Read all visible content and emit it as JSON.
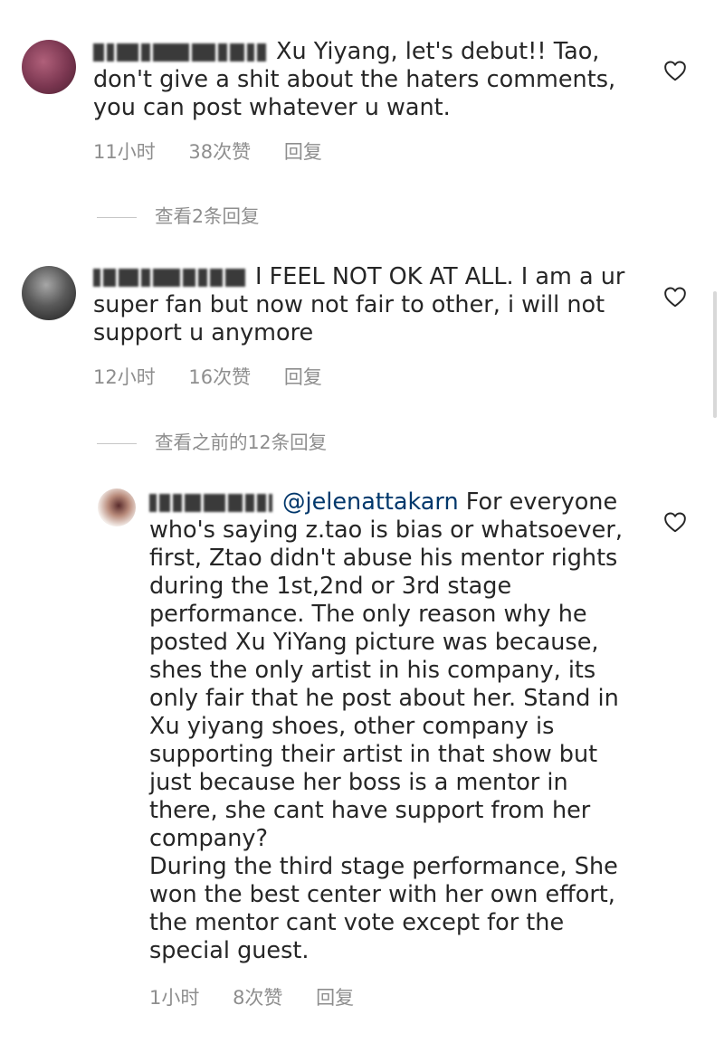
{
  "comments": [
    {
      "text": "Xu Yiyang, let's debut!! Tao, don't give a shit about the haters comments, you can post whatever u want.",
      "time": "11小时",
      "likes": "38次赞",
      "reply": "回复",
      "view_replies": "查看2条回复"
    },
    {
      "text": "I FEEL NOT OK AT ALL. I am a ur super fan but now not fair to other, i will not support u anymore",
      "time": "12小时",
      "likes": "16次赞",
      "reply": "回复",
      "view_replies": "查看之前的12条回复"
    },
    {
      "mention": "@jelenattakarn",
      "text": "For everyone who's saying z.tao is bias or whatsoever, first, Ztao didn't abuse his mentor rights during the 1st,2nd or 3rd stage performance. The only reason why he posted Xu YiYang picture was because, shes the only artist in his company, its only fair that he post about her. Stand in Xu yiyang shoes, other company is supporting their artist in that show but just because her boss is a mentor in there, she cant have support from her company?\nDuring the third stage performance, She won the best center with her own effort, the mentor cant vote except for the special guest.",
      "time": "1小时",
      "likes": "8次赞",
      "reply": "回复"
    }
  ],
  "colors": {
    "text": "#262626",
    "meta": "#8e8e8e",
    "mention": "#00376b"
  },
  "icons": {
    "like": "heart-outline-icon"
  }
}
